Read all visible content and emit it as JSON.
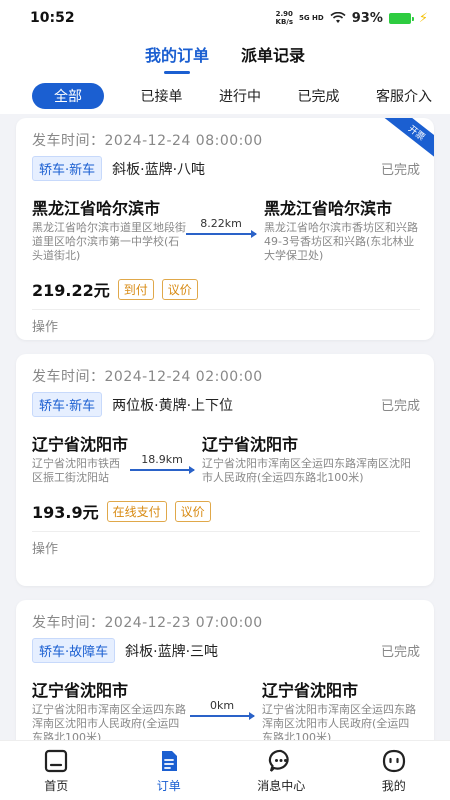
{
  "status_bar": {
    "time": "10:52",
    "net_speed": "2.90\nKB/s",
    "net_type": "5G HD",
    "battery": "93%"
  },
  "top_tabs": [
    {
      "label": "我的订单",
      "active": true
    },
    {
      "label": "派单记录",
      "active": false
    }
  ],
  "filters": [
    {
      "label": "全部",
      "active": true
    },
    {
      "label": "已接单"
    },
    {
      "label": "进行中"
    },
    {
      "label": "已完成"
    },
    {
      "label": "客服介入"
    }
  ],
  "orders": [
    {
      "depart_time": "发车时间：2024-12-24 08:00:00",
      "corner_badge": "开票",
      "car_tag": "轿车·新车",
      "vehicle": "斜板·蓝牌·八吨",
      "status": "已完成",
      "from_city": "黑龙江省哈尔滨市",
      "from_addr": "黑龙江省哈尔滨市道里区地段街道里区哈尔滨市第一中学校(石头道街北)",
      "distance": "8.22km",
      "to_city": "黑龙江省哈尔滨市",
      "to_addr": "黑龙江省哈尔滨市香坊区和兴路49-3号香坊区和兴路(东北林业大学保卫处)",
      "price": "219.22元",
      "pay_type": "到付",
      "negotiable": "议价",
      "op": "操作"
    },
    {
      "depart_time": "发车时间：2024-12-24 02:00:00",
      "corner_badge": "",
      "car_tag": "轿车·新车",
      "vehicle": "两位板·黄牌·上下位",
      "status": "已完成",
      "from_city": "辽宁省沈阳市",
      "from_addr": "辽宁省沈阳市铁西区振工街沈阳站",
      "distance": "18.9km",
      "to_city": "辽宁省沈阳市",
      "to_addr": "辽宁省沈阳市浑南区全运四东路浑南区沈阳市人民政府(全运四东路北100米)",
      "price": "193.9元",
      "pay_type": "在线支付",
      "negotiable": "议价",
      "op": "操作"
    },
    {
      "depart_time": "发车时间：2024-12-23 07:00:00",
      "corner_badge": "",
      "car_tag": "轿车·故障车",
      "vehicle": "斜板·蓝牌·三吨",
      "status": "已完成",
      "from_city": "辽宁省沈阳市",
      "from_addr": "辽宁省沈阳市浑南区全运四东路浑南区沈阳市人民政府(全运四东路北100米)",
      "distance": "0km",
      "to_city": "辽宁省沈阳市",
      "to_addr": "辽宁省沈阳市浑南区全运四东路浑南区沈阳市人民政府(全运四东路北100米)",
      "price": "",
      "pay_type": "",
      "negotiable": "",
      "op": ""
    }
  ],
  "bottom_nav": [
    {
      "label": "首页",
      "icon": "home-icon"
    },
    {
      "label": "订单",
      "icon": "order-icon",
      "active": true
    },
    {
      "label": "消息中心",
      "icon": "message-icon"
    },
    {
      "label": "我的",
      "icon": "profile-icon"
    }
  ],
  "colors": {
    "accent": "#1b5fd1",
    "price_tag": "#d88a12",
    "battery": "#2ecc40"
  }
}
